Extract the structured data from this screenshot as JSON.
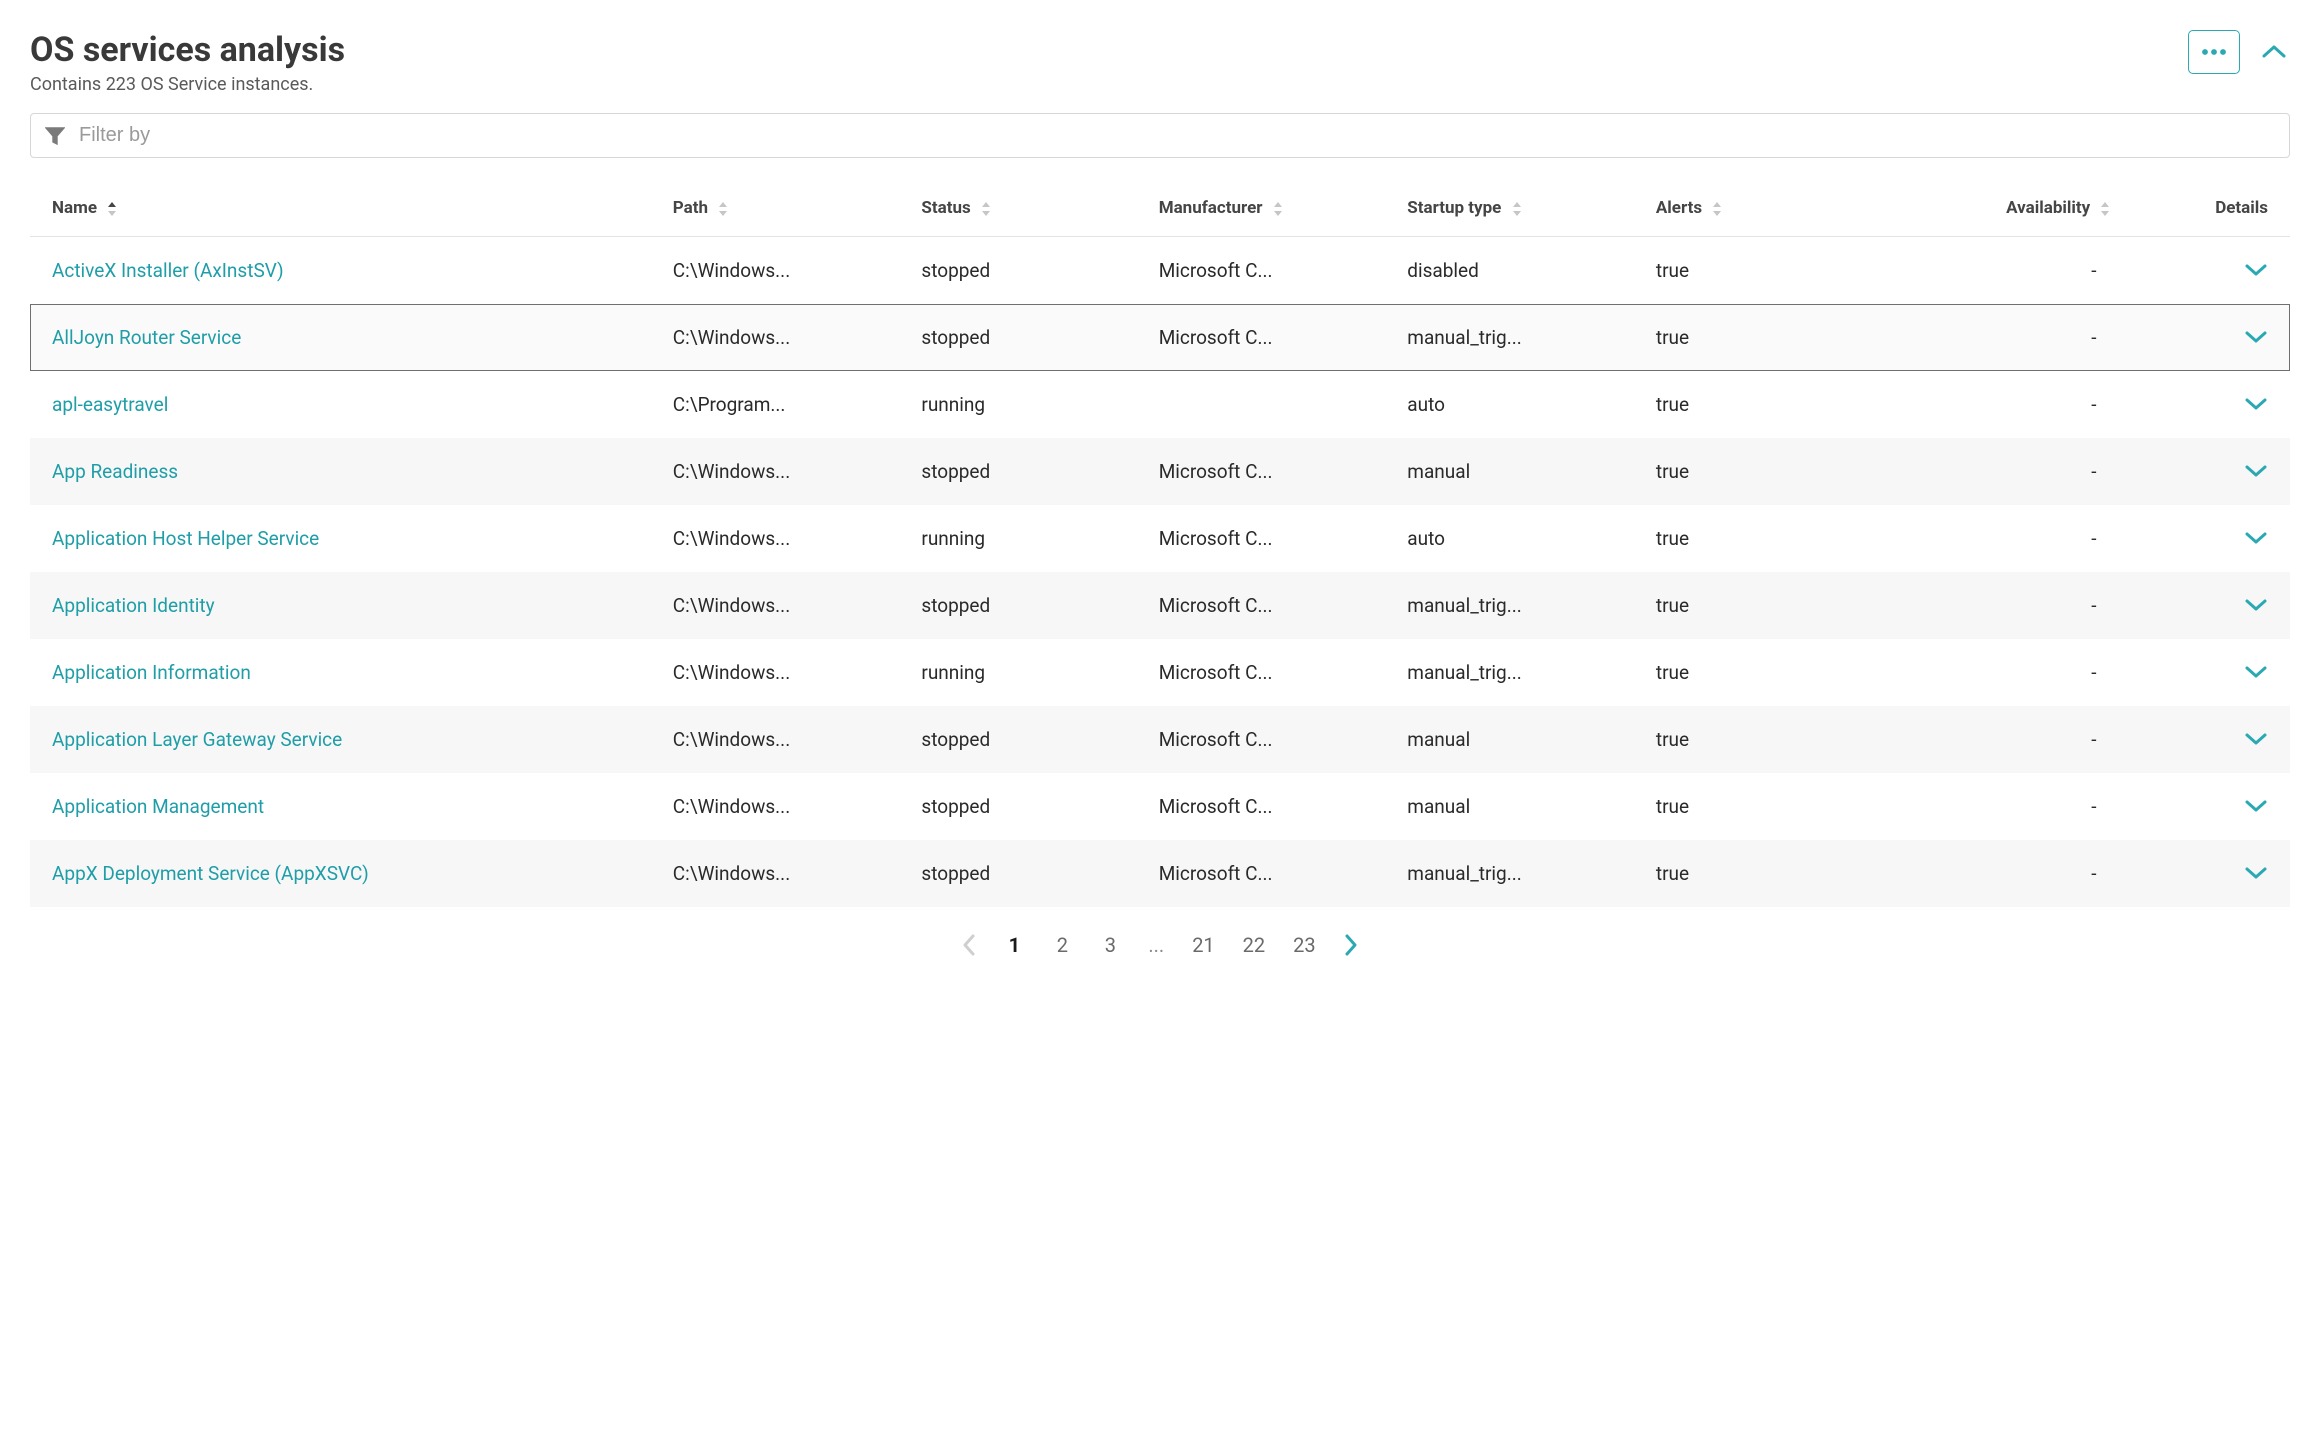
{
  "header": {
    "title": "OS services analysis",
    "subtitle_prefix": "Contains ",
    "subtitle_count": "223",
    "subtitle_suffix": " OS Service instances."
  },
  "filter": {
    "placeholder": "Filter by"
  },
  "columns": {
    "name": "Name",
    "path": "Path",
    "status": "Status",
    "manufacturer": "Manufacturer",
    "startup": "Startup type",
    "alerts": "Alerts",
    "availability": "Availability",
    "details": "Details"
  },
  "rows": [
    {
      "name": "ActiveX Installer (AxInstSV)",
      "path": "C:\\Windows...",
      "status": "stopped",
      "manufacturer": "Microsoft C...",
      "startup": "disabled",
      "alerts": "true",
      "availability": "-",
      "highlighted": false
    },
    {
      "name": "AllJoyn Router Service",
      "path": "C:\\Windows...",
      "status": "stopped",
      "manufacturer": "Microsoft C...",
      "startup": "manual_trig...",
      "alerts": "true",
      "availability": "-",
      "highlighted": true
    },
    {
      "name": "apl-easytravel",
      "path": "C:\\Program...",
      "status": "running",
      "manufacturer": "",
      "startup": "auto",
      "alerts": "true",
      "availability": "-",
      "highlighted": false
    },
    {
      "name": "App Readiness",
      "path": "C:\\Windows...",
      "status": "stopped",
      "manufacturer": "Microsoft C...",
      "startup": "manual",
      "alerts": "true",
      "availability": "-",
      "highlighted": false
    },
    {
      "name": "Application Host Helper Service",
      "path": "C:\\Windows...",
      "status": "running",
      "manufacturer": "Microsoft C...",
      "startup": "auto",
      "alerts": "true",
      "availability": "-",
      "highlighted": false
    },
    {
      "name": "Application Identity",
      "path": "C:\\Windows...",
      "status": "stopped",
      "manufacturer": "Microsoft C...",
      "startup": "manual_trig...",
      "alerts": "true",
      "availability": "-",
      "highlighted": false
    },
    {
      "name": "Application Information",
      "path": "C:\\Windows...",
      "status": "running",
      "manufacturer": "Microsoft C...",
      "startup": "manual_trig...",
      "alerts": "true",
      "availability": "-",
      "highlighted": false
    },
    {
      "name": "Application Layer Gateway Service",
      "path": "C:\\Windows...",
      "status": "stopped",
      "manufacturer": "Microsoft C...",
      "startup": "manual",
      "alerts": "true",
      "availability": "-",
      "highlighted": false
    },
    {
      "name": "Application Management",
      "path": "C:\\Windows...",
      "status": "stopped",
      "manufacturer": "Microsoft C...",
      "startup": "manual",
      "alerts": "true",
      "availability": "-",
      "highlighted": false
    },
    {
      "name": "AppX Deployment Service (AppXSVC)",
      "path": "C:\\Windows...",
      "status": "stopped",
      "manufacturer": "Microsoft C...",
      "startup": "manual_trig...",
      "alerts": "true",
      "availability": "-",
      "highlighted": false
    }
  ],
  "pagination": {
    "pages": [
      "1",
      "2",
      "3",
      "...",
      "21",
      "22",
      "23"
    ],
    "current": "1"
  }
}
